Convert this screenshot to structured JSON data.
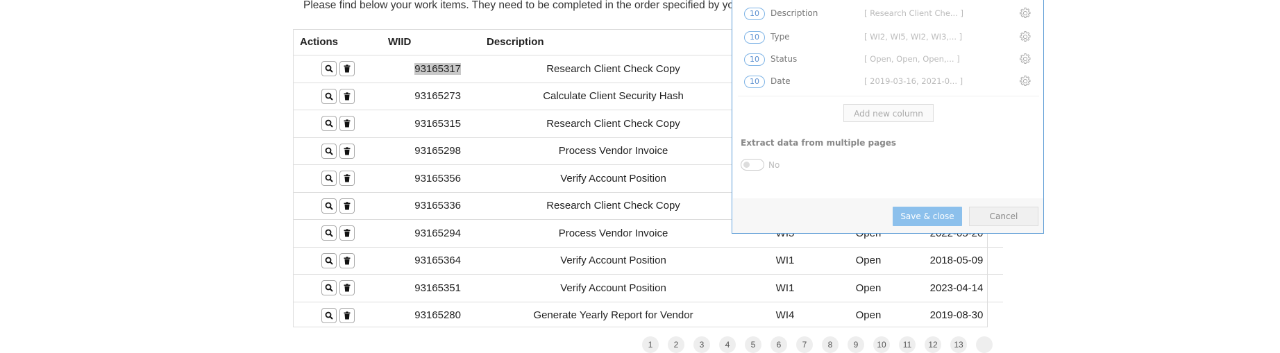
{
  "intro_text": "Please find below your work items. They need to be completed in the order specified by your manag",
  "table": {
    "headers": [
      "Actions",
      "WIID",
      "Description",
      "",
      "",
      ""
    ],
    "rows": [
      {
        "wiid": "93165317",
        "description": "Research Client Check Copy",
        "type": "",
        "status": "",
        "date": ""
      },
      {
        "wiid": "93165273",
        "description": "Calculate Client Security Hash",
        "type": "",
        "status": "",
        "date": ""
      },
      {
        "wiid": "93165315",
        "description": "Research Client Check Copy",
        "type": "",
        "status": "",
        "date": ""
      },
      {
        "wiid": "93165298",
        "description": "Process Vendor Invoice",
        "type": "",
        "status": "",
        "date": ""
      },
      {
        "wiid": "93165356",
        "description": "Verify Account Position",
        "type": "",
        "status": "",
        "date": ""
      },
      {
        "wiid": "93165336",
        "description": "Research Client Check Copy",
        "type": "",
        "status": "",
        "date": ""
      },
      {
        "wiid": "93165294",
        "description": "Process Vendor Invoice",
        "type": "WI5",
        "status": "Open",
        "date": "2022-05-20"
      },
      {
        "wiid": "93165364",
        "description": "Verify Account Position",
        "type": "WI1",
        "status": "Open",
        "date": "2018-05-09"
      },
      {
        "wiid": "93165351",
        "description": "Verify Account Position",
        "type": "WI1",
        "status": "Open",
        "date": "2023-04-14"
      },
      {
        "wiid": "93165280",
        "description": "Generate Yearly Report for Vendor",
        "type": "WI4",
        "status": "Open",
        "date": "2019-08-30"
      }
    ]
  },
  "pagination": {
    "pages": [
      "1",
      "2",
      "3",
      "4",
      "5",
      "6",
      "7",
      "8",
      "9",
      "10",
      "11",
      "12",
      "13",
      ""
    ]
  },
  "panel": {
    "columns": [
      {
        "count": "10",
        "name": "Description",
        "preview": "[ Research Client Che... ]"
      },
      {
        "count": "10",
        "name": "Type",
        "preview": "[ WI2, WI5, WI2, WI3,... ]"
      },
      {
        "count": "10",
        "name": "Status",
        "preview": "[ Open, Open, Open,... ]"
      },
      {
        "count": "10",
        "name": "Date",
        "preview": "[ 2019-03-16, 2021-0... ]"
      }
    ],
    "add_column_label": "Add new column",
    "extract_label": "Extract data from multiple pages",
    "toggle_label": "No",
    "save_label": "Save & close",
    "cancel_label": "Cancel"
  }
}
